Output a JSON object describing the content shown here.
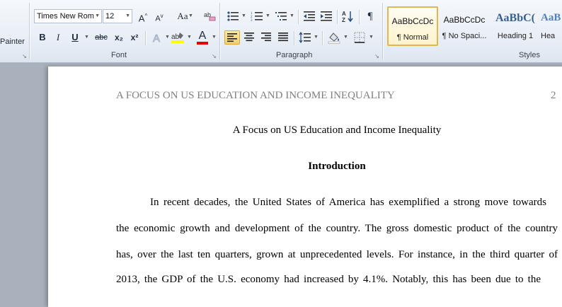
{
  "ribbon": {
    "clipboard": {
      "format_painter_label": "Painter"
    },
    "font": {
      "group_label": "Font",
      "font_name": "Times New Rom",
      "font_size": "12",
      "grow_font": "A",
      "shrink_font": "A",
      "change_case": "Aa",
      "bold": "B",
      "italic": "I",
      "underline": "U",
      "strikethrough": "abc",
      "subscript": "x₂",
      "superscript": "x²",
      "font_color": "A"
    },
    "paragraph": {
      "group_label": "Paragraph",
      "show_marks": "¶"
    },
    "styles": {
      "group_label": "Styles",
      "items": [
        {
          "sample": "AaBbCcDc",
          "name": "¶ Normal"
        },
        {
          "sample": "AaBbCcDc",
          "name": "¶ No Spaci..."
        },
        {
          "sample": "AaBbC(",
          "name": "Heading 1"
        },
        {
          "sample": "AaB",
          "name": "Hea"
        }
      ]
    }
  },
  "document": {
    "header_title": "A FOCUS ON US EDUCATION AND INCOME INEQUALITY",
    "header_page_number": "2",
    "title": "A Focus on US Education and Income Inequality",
    "heading": "Introduction",
    "lines": [
      "In recent decades, the United States of America has exemplified a strong move towards",
      "the economic growth and development of the country. The gross domestic product of the country",
      "has, over the last ten quarters, grown at unprecedented levels. For instance, in the third quarter of",
      "2013, the GDP of the U.S. economy had increased by 4.1%. Notably, this has been due to the"
    ]
  },
  "colors": {
    "highlight": "#ffff00",
    "font_color_bar": "#e00000",
    "selected_button": "#f7cf66",
    "header_text": "#808080"
  }
}
